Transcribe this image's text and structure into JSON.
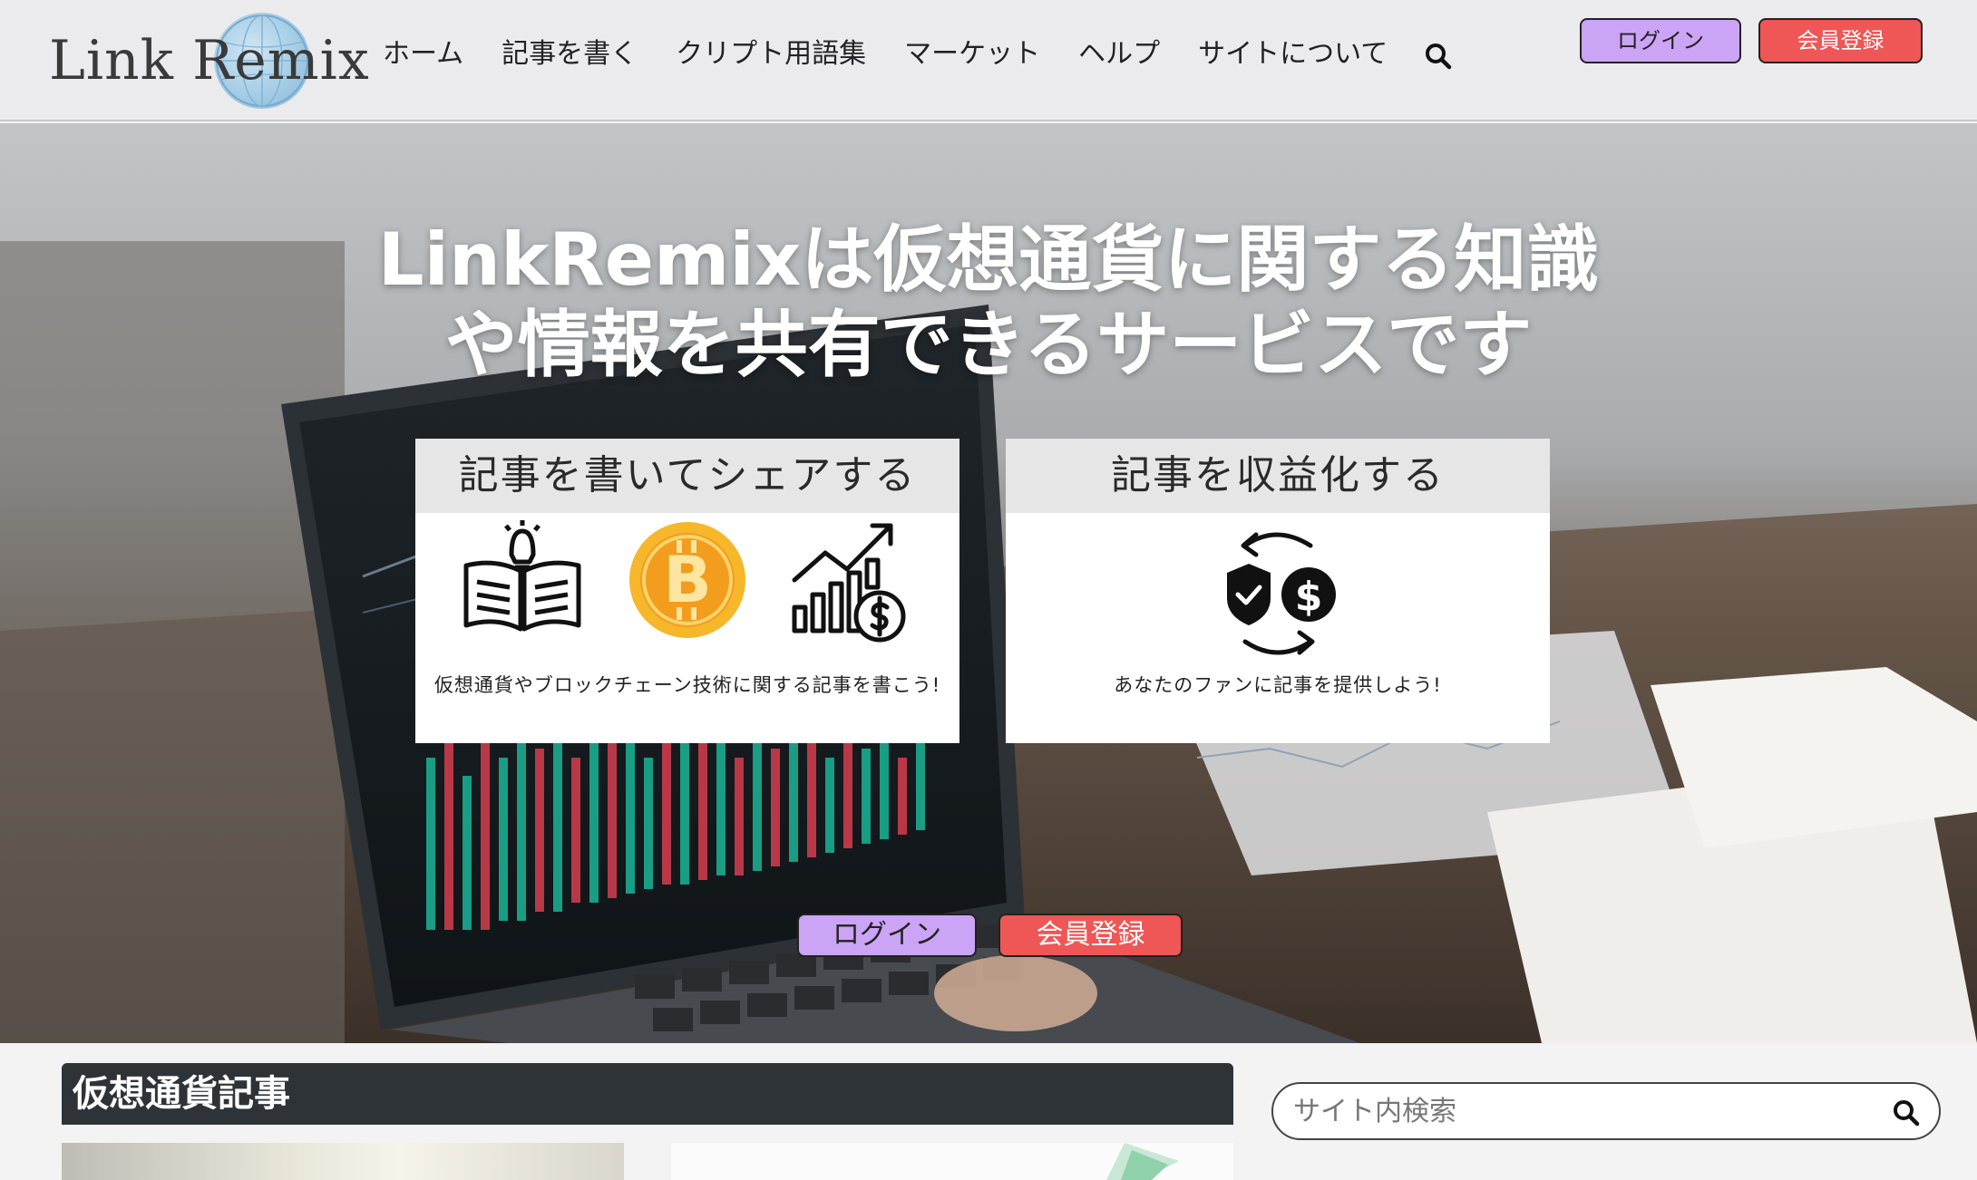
{
  "header": {
    "logo_text": "Link Remix",
    "nav": [
      "ホーム",
      "記事を書く",
      "クリプト用語集",
      "マーケット",
      "ヘルプ",
      "サイトについて"
    ],
    "login_label": "ログイン",
    "signup_label": "会員登録"
  },
  "hero": {
    "title_line1": "LinkRemixは仮想通貨に関する知識",
    "title_line2": "や情報を共有できるサービスです",
    "card_write": {
      "title": "記事を書いてシェアする",
      "text": "仮想通貨やブロックチェーン技術に関する記事を書こう!",
      "icons": [
        "book-idea-icon",
        "bitcoin-icon",
        "growth-chart-dollar-icon"
      ]
    },
    "card_monetize": {
      "title": "記事を収益化する",
      "text": "あなたのファンに記事を提供しよう!",
      "icons": [
        "shield-dollar-exchange-icon"
      ]
    },
    "login_label": "ログイン",
    "signup_label": "会員登録"
  },
  "articles": {
    "section_title": "仮想通貨記事"
  },
  "search": {
    "placeholder": "サイト内検索"
  },
  "colors": {
    "login_bg": "#cba4f6",
    "signup_bg": "#ef5656",
    "section_head_bg": "#2e3338"
  }
}
